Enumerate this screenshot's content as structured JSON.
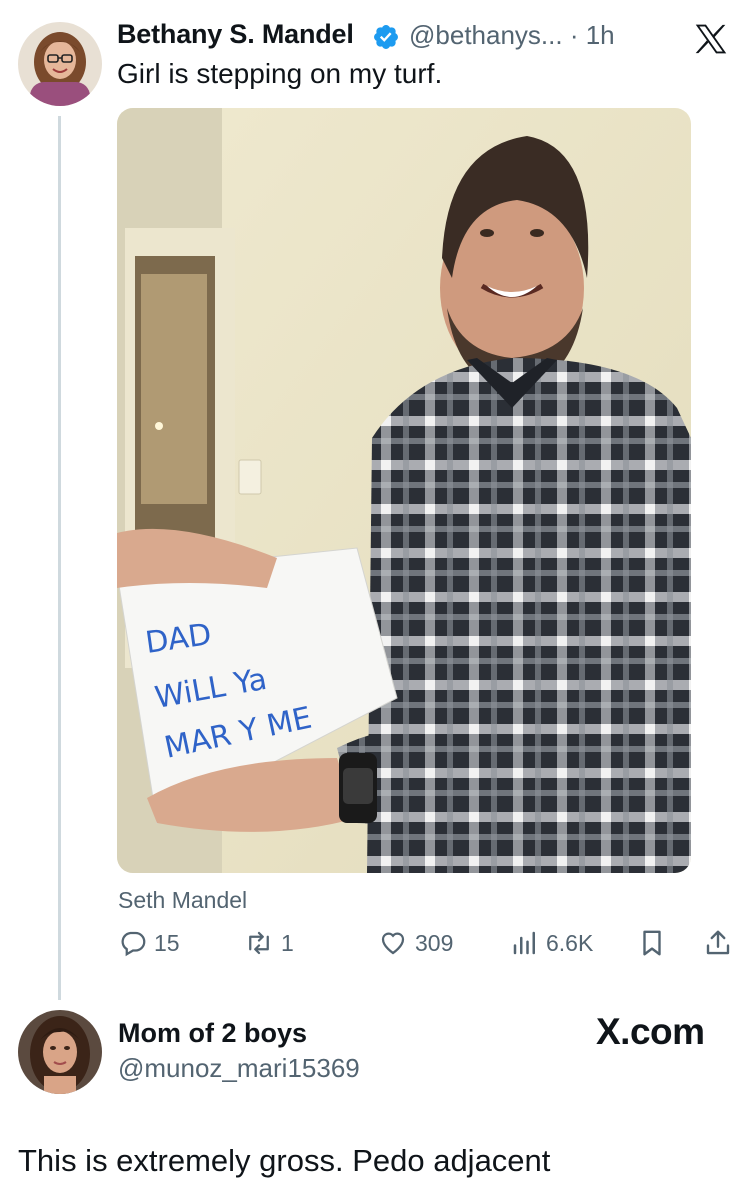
{
  "tweet": {
    "author_name": "Bethany S. Mandel",
    "verified": true,
    "handle": "@bethanys...",
    "time": "· 1h",
    "text": "Girl is stepping on my turf.",
    "media_caption": "Seth Mandel",
    "media_note_lines": [
      "DAD",
      "WiLL Ya",
      "MAR  Y ME"
    ],
    "actions": {
      "replies": "15",
      "retweets": "1",
      "likes": "309",
      "views": "6.6K"
    },
    "icons": [
      "verified-badge-icon",
      "x-logo-icon",
      "reply-icon",
      "retweet-icon",
      "like-icon",
      "views-icon",
      "bookmark-icon",
      "share-icon"
    ]
  },
  "reply": {
    "author_name": "Mom of 2 boys",
    "handle": "@munoz_mari15369",
    "watermark": "X.com",
    "text": "This is extremely gross. Pedo adjacent"
  },
  "colors": {
    "text": "#0f1419",
    "secondary": "#536471",
    "verified": "#1d9bf0",
    "thread_line": "#cfd9de"
  }
}
